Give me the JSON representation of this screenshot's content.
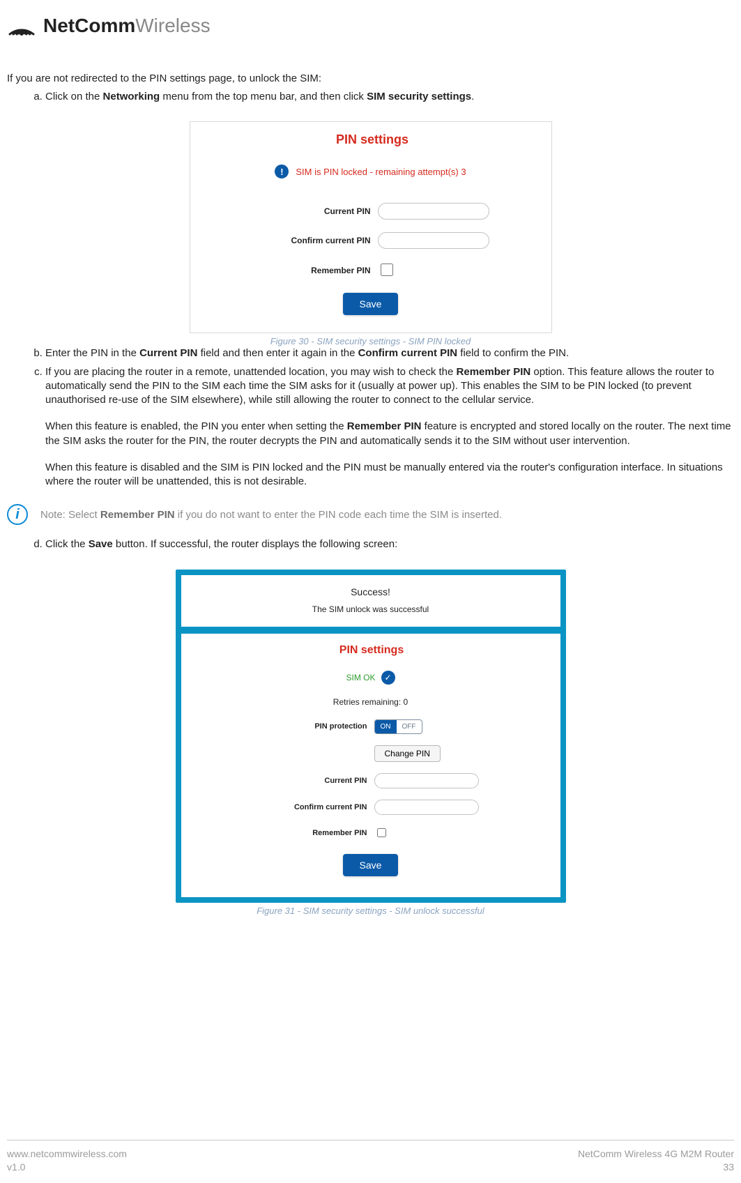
{
  "brand": {
    "name_bold": "NetComm",
    "name_light": "Wireless"
  },
  "intro": "If you are not redirected to the PIN settings page, to unlock the SIM:",
  "steps": {
    "a": {
      "pre": "Click on the ",
      "b1": "Networking",
      "mid": " menu from the top menu bar, and then click ",
      "b2": "SIM security settings",
      "post": "."
    },
    "b": {
      "pre": "Enter the PIN in the ",
      "b1": "Current PIN",
      "mid": " field and then enter it again in the ",
      "b2": "Confirm current PIN",
      "post": " field to confirm the PIN."
    },
    "c": {
      "p1_pre": "If you are placing the router in a remote, unattended location, you may wish to check the ",
      "p1_b": "Remember PIN",
      "p1_post": " option. This feature allows the router to automatically send the PIN to the SIM each time the SIM asks for it (usually at power up). This enables the SIM to be PIN locked (to prevent unauthorised re-use of the SIM elsewhere), while still allowing the router to connect to the cellular service.",
      "p2_pre": "When this feature is enabled, the PIN you enter when setting the ",
      "p2_b": "Remember PIN",
      "p2_post": " feature is encrypted and stored locally on the router. The next time the SIM asks the router for the PIN, the router decrypts the PIN and automatically sends it to the SIM without user intervention.",
      "p3": "When this feature is disabled and the SIM is PIN locked and the PIN must be manually entered via the router's configuration interface. In situations where the router will be unattended, this is not desirable."
    },
    "d": {
      "pre": "Click the ",
      "b1": "Save",
      "post": " button. If successful, the router displays the following screen:"
    }
  },
  "fig30": {
    "title": "PIN settings",
    "alert": "SIM is PIN locked - remaining attempt(s) 3",
    "labels": {
      "current": "Current PIN",
      "confirm": "Confirm current PIN",
      "remember": "Remember PIN"
    },
    "save": "Save",
    "caption": "Figure 30 - SIM security settings - SIM PIN locked"
  },
  "note": {
    "pre": "Note: Select ",
    "b": "Remember PIN",
    "post": " if you do not want to enter the PIN code each time the SIM is inserted."
  },
  "fig31": {
    "success_title": "Success!",
    "success_msg": "The SIM unlock was successful",
    "title": "PIN settings",
    "sim_ok": "SIM OK",
    "retries": "Retries remaining: 0",
    "labels": {
      "protection": "PIN protection",
      "current": "Current PIN",
      "confirm": "Confirm current PIN",
      "remember": "Remember PIN"
    },
    "toggle": {
      "on": "ON",
      "off": "OFF"
    },
    "change_pin": "Change PIN",
    "save": "Save",
    "caption": "Figure 31 - SIM security settings - SIM unlock successful"
  },
  "footer": {
    "url": "www.netcommwireless.com",
    "version": "v1.0",
    "product": "NetComm Wireless 4G M2M Router",
    "page": "33"
  }
}
